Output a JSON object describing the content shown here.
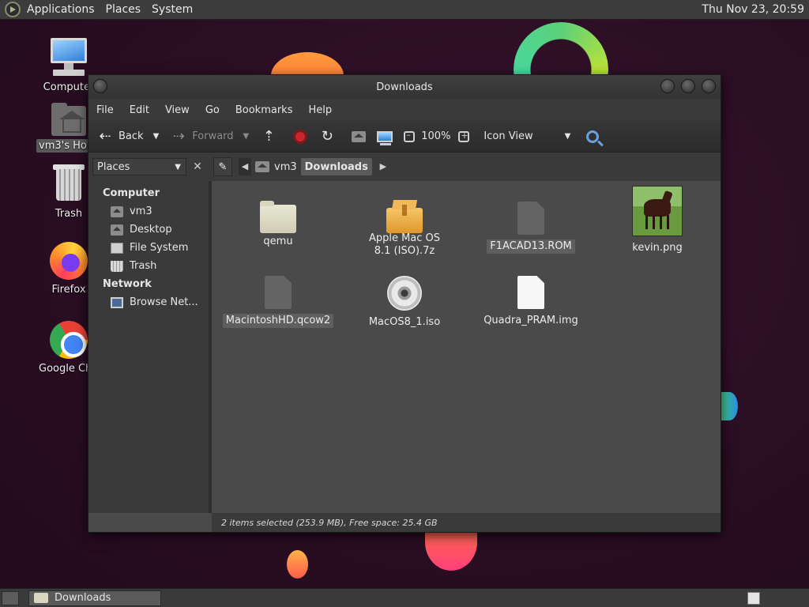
{
  "top_panel": {
    "menus": [
      "Applications",
      "Places",
      "System"
    ],
    "clock": "Thu Nov 23, 20:59"
  },
  "desktop_icons": [
    {
      "label": "Computer",
      "icon": "computer-icon"
    },
    {
      "label": "vm3's Home",
      "icon": "home-folder-icon"
    },
    {
      "label": "Trash",
      "icon": "trash-icon"
    },
    {
      "label": "Firefox",
      "icon": "firefox-icon"
    },
    {
      "label": "Google Chrome",
      "icon": "chrome-icon"
    }
  ],
  "window": {
    "title": "Downloads",
    "menu": [
      "File",
      "Edit",
      "View",
      "Go",
      "Bookmarks",
      "Help"
    ],
    "toolbar": {
      "back": "Back",
      "forward": "Forward",
      "zoom": "100%",
      "view_mode": "Icon View"
    },
    "places_label": "Places",
    "breadcrumbs": [
      "vm3",
      "Downloads"
    ],
    "sidebar": {
      "computer_title": "Computer",
      "computer_items": [
        "vm3",
        "Desktop",
        "File System",
        "Trash"
      ],
      "network_title": "Network",
      "network_items": [
        "Browse Net..."
      ]
    },
    "files": [
      {
        "name": "qemu",
        "type": "folder",
        "selected": false
      },
      {
        "name": "Apple Mac OS 8.1 (ISO).7z",
        "type": "archive",
        "selected": false
      },
      {
        "name": "F1ACAD13.ROM",
        "type": "generic",
        "selected": true
      },
      {
        "name": "kevin.png",
        "type": "image",
        "selected": false
      },
      {
        "name": "MacintoshHD.qcow2",
        "type": "generic",
        "selected": true
      },
      {
        "name": "MacOS8_1.iso",
        "type": "disc",
        "selected": false
      },
      {
        "name": "Quadra_PRAM.img",
        "type": "text",
        "selected": false
      }
    ],
    "status": "2 items selected (253.9 MB), Free space: 25.4 GB"
  },
  "taskbar": {
    "tasks": [
      "Downloads"
    ]
  }
}
